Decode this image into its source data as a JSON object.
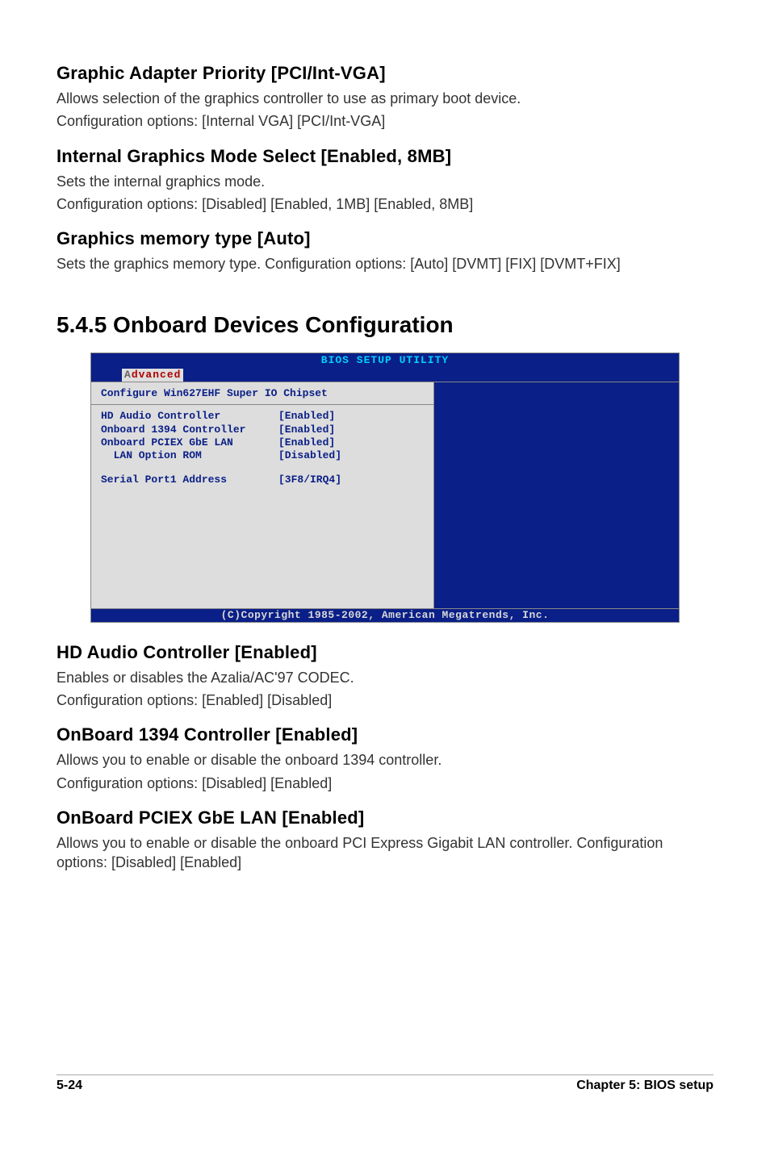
{
  "s1": {
    "heading": "Graphic Adapter Priority [PCI/Int-VGA]",
    "p1": "Allows selection of the graphics controller to use as primary boot device.",
    "p2": "Configuration options: [Internal VGA] [PCI/Int-VGA]"
  },
  "s2": {
    "heading": "Internal Graphics Mode Select [Enabled, 8MB]",
    "p1": "Sets the internal graphics mode.",
    "p2": "Configuration options: [Disabled] [Enabled, 1MB] [Enabled, 8MB]"
  },
  "s3": {
    "heading": "Graphics memory type [Auto]",
    "p1": "Sets the graphics memory type. Configuration options: [Auto] [DVMT] [FIX] [DVMT+FIX]"
  },
  "chapter": {
    "heading": "5.4.5   Onboard Devices Configuration"
  },
  "bios": {
    "title": "BIOS SETUP UTILITY",
    "tabA": "A",
    "tabRest": "dvanced",
    "left_header": "Configure Win627EHF Super IO Chipset",
    "rows": [
      {
        "label": "HD Audio Controller",
        "value": "[Enabled]"
      },
      {
        "label": "Onboard 1394 Controller",
        "value": "[Enabled]"
      },
      {
        "label": "Onboard PCIEX GbE LAN",
        "value": "[Enabled]"
      },
      {
        "label": "  LAN Option ROM",
        "value": "[Disabled]"
      }
    ],
    "serial": {
      "label": "Serial Port1 Address",
      "value": "[3F8/IRQ4]"
    },
    "footer": "(C)Copyright 1985-2002, American Megatrends, Inc."
  },
  "s4": {
    "heading": "HD Audio Controller [Enabled]",
    "p1": "Enables or disables the Azalia/AC'97 CODEC.",
    "p2": "Configuration options: [Enabled] [Disabled]"
  },
  "s5": {
    "heading": "OnBoard 1394 Controller [Enabled]",
    "p1": "Allows you to enable or disable the onboard 1394 controller.",
    "p2": "Configuration options: [Disabled] [Enabled]"
  },
  "s6": {
    "heading": "OnBoard PCIEX GbE LAN [Enabled]",
    "p1": "Allows you to enable or disable the onboard PCI Express Gigabit LAN controller.  Configuration options: [Disabled] [Enabled]"
  },
  "footer": {
    "left": "5-24",
    "right": "Chapter 5: BIOS setup"
  }
}
